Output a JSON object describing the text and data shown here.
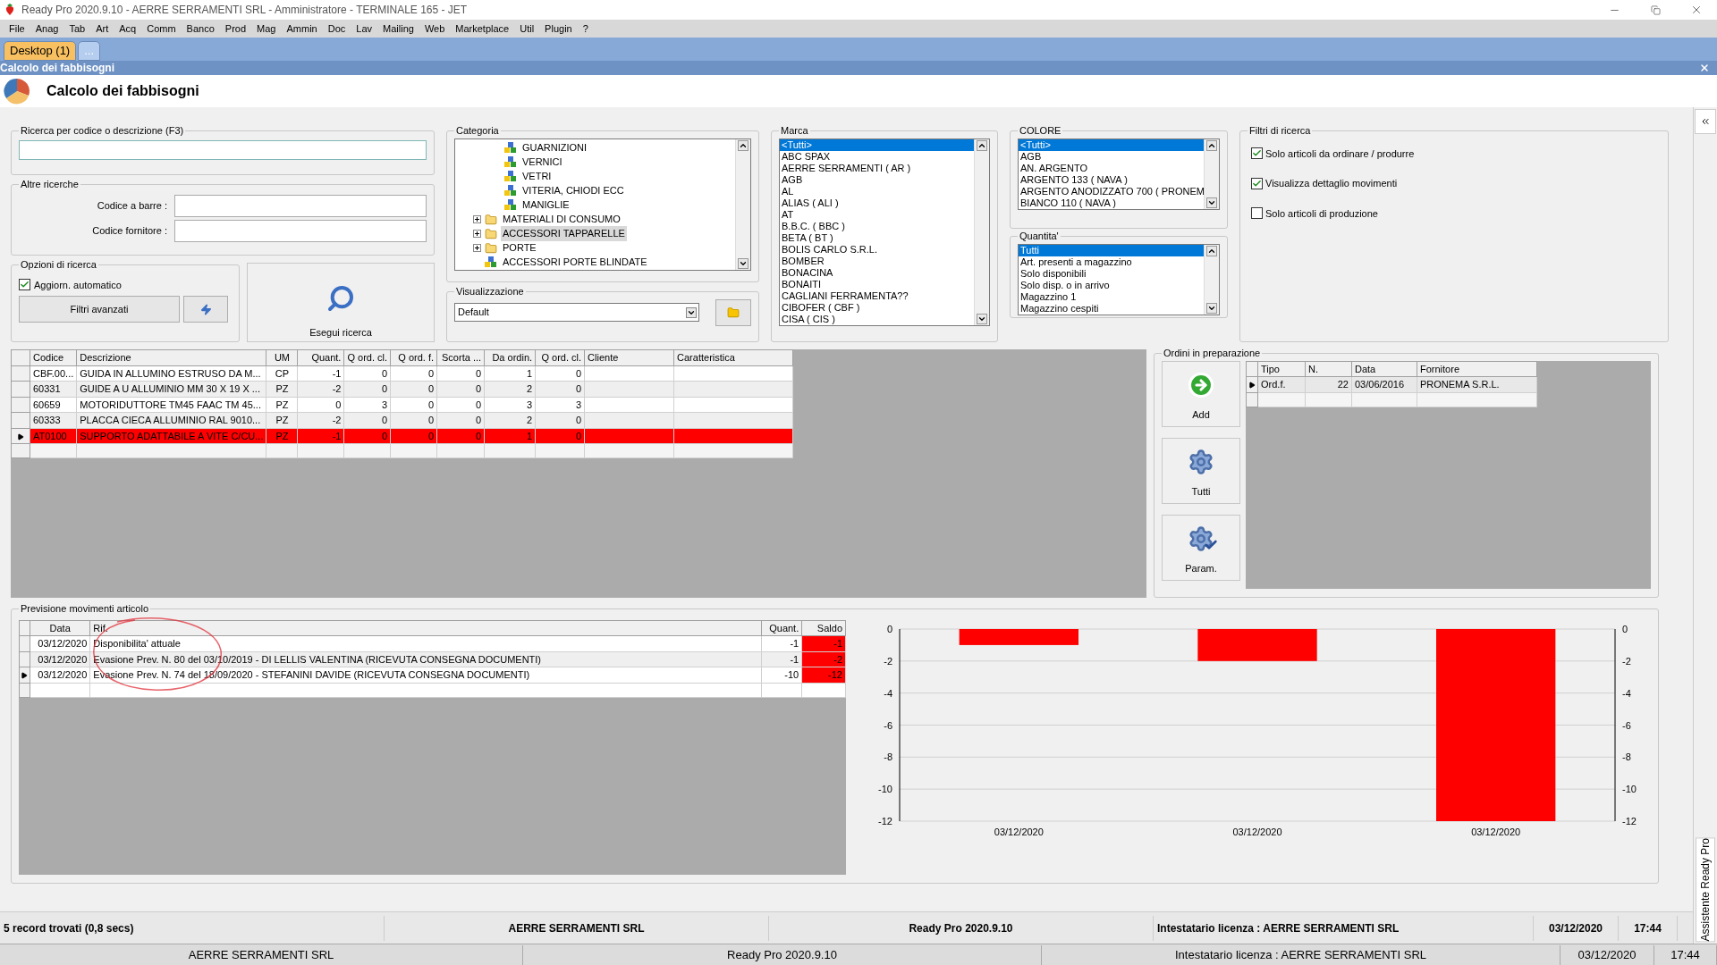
{
  "window": {
    "title": "Ready Pro 2020.9.10 - AERRE SERRAMENTI SRL - Amministratore - TERMINALE 165 - JET"
  },
  "menu": [
    "File",
    "Anag",
    "Tab",
    "Art",
    "Acq",
    "Comm",
    "Banco",
    "Prod",
    "Mag",
    "Ammin",
    "Doc",
    "Lav",
    "Mailing",
    "Web",
    "Marketplace",
    "Util",
    "Plugin",
    "?"
  ],
  "desktop_tabs": [
    {
      "label": "Desktop (1)",
      "selected": true
    },
    {
      "label": "...",
      "selected": false
    }
  ],
  "child_window": {
    "title": "Calcolo dei fabbisogni"
  },
  "header": {
    "title": "Calcolo dei fabbisogni"
  },
  "search": {
    "label": "Ricerca per codice o descrizione (F3)"
  },
  "other_searches": {
    "label": "Altre ricerche",
    "fields": [
      {
        "label": "Codice a barre :"
      },
      {
        "label": "Codice fornitore :"
      }
    ]
  },
  "search_options": {
    "label": "Opzioni di ricerca",
    "auto_update": {
      "label": "Aggiorn. automatico",
      "checked": true
    },
    "advanced_button": "Filtri avanzati"
  },
  "run_search": {
    "label": "Esegui ricerca"
  },
  "category": {
    "label": "Categoria",
    "items": [
      {
        "children": [
          {
            "label": "GUARNIZIONI",
            "kind": "leaf",
            "selected": false
          },
          {
            "label": "VERNICI",
            "kind": "leaf",
            "selected": false
          },
          {
            "label": "VETRI",
            "kind": "leaf",
            "selected": false
          },
          {
            "label": "VITERIA, CHIODI ECC",
            "kind": "leaf",
            "selected": false
          },
          {
            "label": "MANIGLIE",
            "kind": "leaf",
            "selected": false
          }
        ]
      },
      {
        "label": "MATERIALI DI CONSUMO",
        "kind": "folder",
        "expanded": false,
        "selected": false
      },
      {
        "label": "ACCESSORI TAPPARELLE",
        "kind": "folder",
        "expanded": false,
        "selected": true
      },
      {
        "label": "PORTE",
        "kind": "folder",
        "expanded": false,
        "selected": false
      },
      {
        "label": "ACCESSORI PORTE BLINDATE",
        "kind": "leaf",
        "selected": false
      }
    ]
  },
  "view": {
    "label": "Visualizzazione",
    "value": "Default"
  },
  "brand": {
    "label": "Marca",
    "items": [
      {
        "label": "<Tutti>",
        "selected": true
      },
      {
        "label": "ABC SPAX",
        "selected": false
      },
      {
        "label": "AERRE SERRAMENTI ( AR )",
        "selected": false
      },
      {
        "label": "AGB",
        "selected": false
      },
      {
        "label": "AL",
        "selected": false
      },
      {
        "label": "ALIAS ( ALI )",
        "selected": false
      },
      {
        "label": "AT",
        "selected": false
      },
      {
        "label": "B.B.C. ( BBC )",
        "selected": false
      },
      {
        "label": "BETA ( BT )",
        "selected": false
      },
      {
        "label": "BOLIS CARLO S.R.L.",
        "selected": false
      },
      {
        "label": "BOMBER",
        "selected": false
      },
      {
        "label": "BONACINA",
        "selected": false
      },
      {
        "label": "BONAITI",
        "selected": false
      },
      {
        "label": "CAGLIANI FERRAMENTA??",
        "selected": false
      },
      {
        "label": "CIBOFER  ( CBF )",
        "selected": false
      },
      {
        "label": "CISA ( CIS )",
        "selected": false
      }
    ]
  },
  "color": {
    "label": "COLORE",
    "items": [
      {
        "label": "<Tutti>",
        "selected": true
      },
      {
        "label": "AGB",
        "selected": false
      },
      {
        "label": "AN. ARGENTO",
        "selected": false
      },
      {
        "label": "ARGENTO 133 ( NAVA )",
        "selected": false
      },
      {
        "label": "ARGENTO ANODIZZATO 700 ( PRONEM",
        "selected": false
      },
      {
        "label": "BIANCO 110 ( NAVA )",
        "selected": false
      }
    ]
  },
  "quantity": {
    "label": "Quantita'",
    "items": [
      {
        "label": "Tutti",
        "selected": true
      },
      {
        "label": "Art. presenti a magazzino",
        "selected": false
      },
      {
        "label": "Solo disponibili",
        "selected": false
      },
      {
        "label": "Solo disp. o in arrivo",
        "selected": false
      },
      {
        "label": "Magazzino 1",
        "selected": false
      },
      {
        "label": "Magazzino cespiti",
        "selected": false
      }
    ]
  },
  "filters": {
    "label": "Filtri di ricerca",
    "options": [
      {
        "label": "Solo articoli da ordinare / produrre",
        "checked": true
      },
      {
        "label": "Visualizza dettaglio movimenti",
        "checked": true
      },
      {
        "label": "Solo articoli di produzione",
        "checked": false
      }
    ]
  },
  "articles": {
    "columns": [
      "Codice",
      "Descrizione",
      "UM",
      "Quant.",
      "Q ord. cl.",
      "Q ord. f.",
      "Scorta ...",
      "Da ordin.",
      "Q ord. cl.",
      "Cliente",
      "Caratteristica"
    ],
    "rows": [
      {
        "cells": [
          "CBF.00...",
          "GUIDA IN ALLUMINO ESTRUSO DA M...",
          "CP",
          "-1",
          "0",
          "0",
          "0",
          "1",
          "0"
        ],
        "current": false,
        "alert": false
      },
      {
        "cells": [
          "60331",
          "GUIDE A U ALLUMINIO MM 30 X 19 X ...",
          "PZ",
          "-2",
          "0",
          "0",
          "0",
          "2",
          "0"
        ],
        "current": false,
        "alert": false
      },
      {
        "cells": [
          "60659",
          "MOTORIDUTTORE TM45 FAAC TM 45...",
          "PZ",
          "0",
          "3",
          "0",
          "0",
          "3",
          "3"
        ],
        "current": false,
        "alert": false
      },
      {
        "cells": [
          "60333",
          "PLACCA CIECA ALLUMINIO RAL 9010...",
          "PZ",
          "-2",
          "0",
          "0",
          "0",
          "2",
          "0"
        ],
        "current": false,
        "alert": false
      },
      {
        "cells": [
          "AT0100",
          "SUPPORTO ADATTABILE A VITE C/CU...",
          "PZ",
          "-1",
          "0",
          "0",
          "0",
          "1",
          "0"
        ],
        "current": true,
        "alert": true
      }
    ]
  },
  "orders": {
    "label": "Ordini in preparazione",
    "buttons": [
      {
        "label": "Add",
        "kind": "add"
      },
      {
        "label": "Tutti",
        "kind": "gears"
      },
      {
        "label": "Param.",
        "kind": "gears-check"
      }
    ],
    "columns": [
      "Tipo",
      "N.",
      "Data",
      "Fornitore"
    ],
    "rows": [
      {
        "cells": [
          "Ord.f.",
          "22",
          "03/06/2016",
          "PRONEMA S.R.L."
        ],
        "current": true
      }
    ]
  },
  "forecast": {
    "label": "Previsione movimenti articolo",
    "columns": [
      "Data",
      "Rif.",
      "Quant.",
      "Saldo"
    ],
    "rows": [
      {
        "cells": [
          "03/12/2020",
          "Disponibilita' attuale",
          "-1",
          "-1"
        ],
        "current": false,
        "negative": true
      },
      {
        "cells": [
          "03/12/2020",
          "Evasione Prev. N. 80 del 03/10/2019 - DI LELLIS VALENTINA (RICEVUTA CONSEGNA DOCUMENTI)",
          "-1",
          "-2"
        ],
        "current": false,
        "negative": true
      },
      {
        "cells": [
          "03/12/2020",
          "Evasione Prev. N. 74 del 18/09/2020 - STEFANINI DAVIDE (RICEVUTA CONSEGNA DOCUMENTI)",
          "-10",
          "-12"
        ],
        "current": true,
        "negative": true
      }
    ],
    "chart_data": {
      "type": "bar",
      "categories": [
        "03/12/2020",
        "03/12/2020",
        "03/12/2020"
      ],
      "series": [
        {
          "color": "#ff0000",
          "values": [
            -1,
            -2,
            -12
          ]
        }
      ],
      "ylim": [
        -12,
        0
      ],
      "yticks": [
        0,
        -2,
        -4,
        -6,
        -8,
        -10,
        -12
      ],
      "grid": true
    },
    "right_axis_labels": [
      "0",
      "-2",
      "-4",
      "-6",
      "-8",
      "-10",
      "-12"
    ]
  },
  "status_bar": [
    "5 record trovati (0,8 secs)",
    "AERRE SERRAMENTI SRL",
    "Ready Pro 2020.9.10",
    "Intestatario licenza : AERRE SERRAMENTI SRL",
    "03/12/2020",
    "17:44"
  ],
  "bottom_bar": [
    "AERRE SERRAMENTI SRL",
    "Ready Pro 2020.9.10",
    "Intestatario licenza : AERRE SERRAMENTI SRL",
    "03/12/2020",
    "17:44"
  ],
  "side_panel": {
    "label": "Assistente Ready Pro"
  }
}
